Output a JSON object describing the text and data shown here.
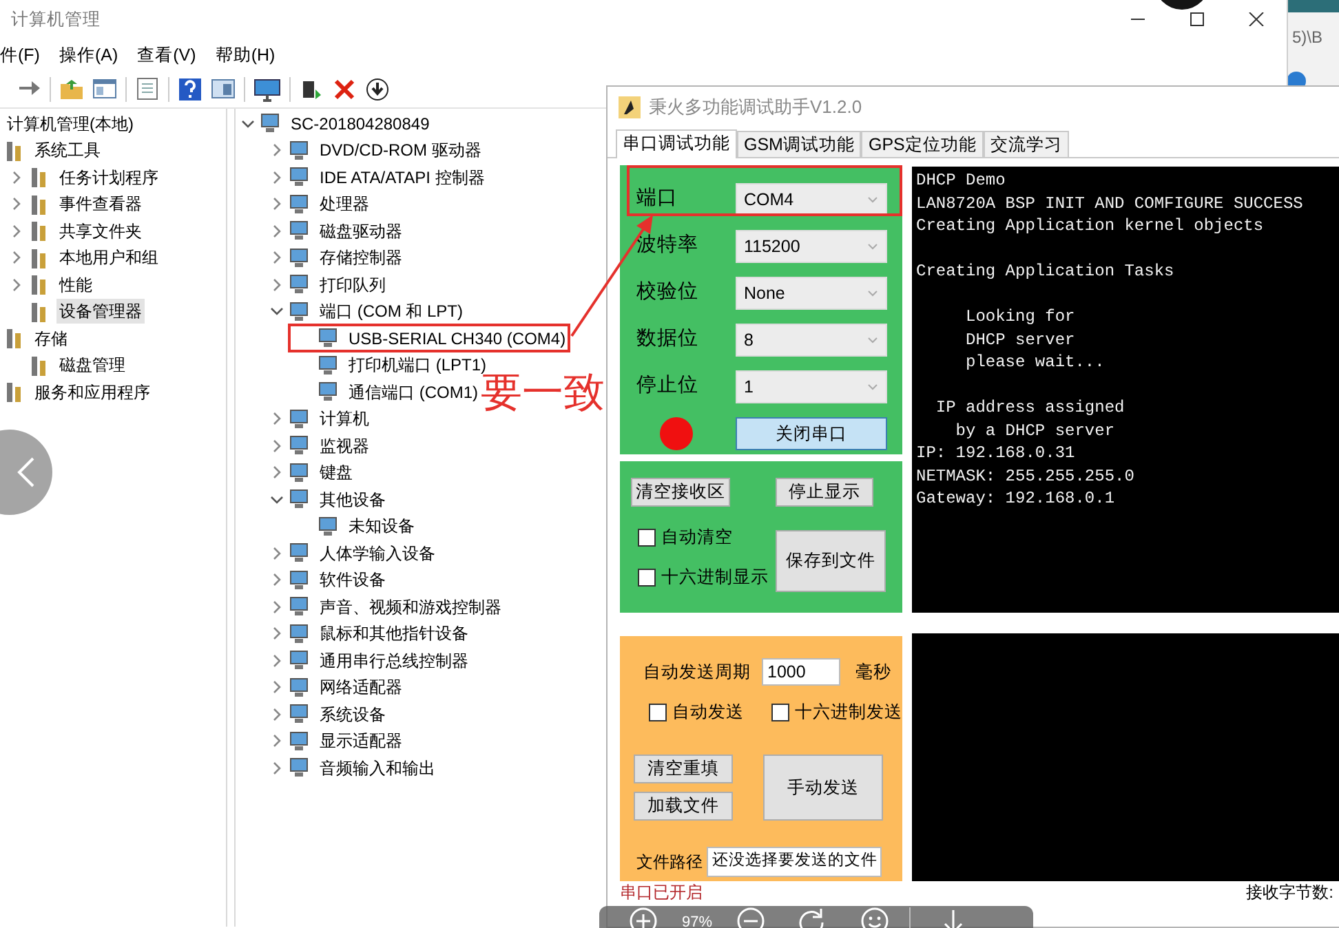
{
  "main_window": {
    "title": "计算机管理",
    "menu": [
      "件(F)",
      "操作(A)",
      "查看(V)",
      "帮助(H)"
    ],
    "nav_tree": [
      {
        "label": "计算机管理(本地)",
        "selected": false,
        "children": [
          {
            "label": "系统工具",
            "selected": false,
            "children": [
              {
                "label": "任务计划程序",
                "expanded": false,
                "selected": false
              },
              {
                "label": "事件查看器",
                "expanded": false,
                "selected": false
              },
              {
                "label": "共享文件夹",
                "expanded": false,
                "selected": false
              },
              {
                "label": "本地用户和组",
                "expanded": false,
                "selected": false
              },
              {
                "label": "性能",
                "expanded": false,
                "selected": false
              },
              {
                "label": "设备管理器",
                "selected": true
              }
            ]
          },
          {
            "label": "存储",
            "selected": false,
            "children": [
              {
                "label": "磁盘管理",
                "selected": false
              }
            ]
          },
          {
            "label": "服务和应用程序",
            "selected": false
          }
        ]
      }
    ],
    "device_tree": [
      {
        "label": "SC-201804280849",
        "expanded": true,
        "children": [
          {
            "label": "DVD/CD-ROM 驱动器",
            "expanded": false
          },
          {
            "label": "IDE ATA/ATAPI 控制器",
            "expanded": false
          },
          {
            "label": "处理器",
            "expanded": false
          },
          {
            "label": "磁盘驱动器",
            "expanded": false
          },
          {
            "label": "存储控制器",
            "expanded": false
          },
          {
            "label": "打印队列",
            "expanded": false
          },
          {
            "label": "端口 (COM 和 LPT)",
            "expanded": true,
            "children": [
              {
                "label": "USB-SERIAL CH340 (COM4)"
              },
              {
                "label": "打印机端口 (LPT1)"
              },
              {
                "label": "通信端口 (COM1)"
              }
            ]
          },
          {
            "label": "计算机",
            "expanded": false
          },
          {
            "label": "监视器",
            "expanded": false
          },
          {
            "label": "键盘",
            "expanded": false
          },
          {
            "label": "其他设备",
            "expanded": true,
            "children": [
              {
                "label": "未知设备"
              }
            ]
          },
          {
            "label": "人体学输入设备",
            "expanded": false
          },
          {
            "label": "软件设备",
            "expanded": false
          },
          {
            "label": "声音、视频和游戏控制器",
            "expanded": false
          },
          {
            "label": "鼠标和其他指针设备",
            "expanded": false
          },
          {
            "label": "通用串行总线控制器",
            "expanded": false
          },
          {
            "label": "网络适配器",
            "expanded": false
          },
          {
            "label": "系统设备",
            "expanded": false
          },
          {
            "label": "显示适配器",
            "expanded": false
          },
          {
            "label": "音频输入和输出",
            "expanded": false
          }
        ]
      }
    ]
  },
  "serial_tool": {
    "title": "秉火多功能调试助手V1.2.0",
    "tabs": [
      {
        "label": "串口调试功能",
        "selected": true
      },
      {
        "label": "GSM调试功能",
        "selected": false
      },
      {
        "label": "GPS定位功能",
        "selected": false
      },
      {
        "label": "交流学习",
        "selected": false
      }
    ],
    "settings": [
      {
        "label": "端口",
        "value": "COM4"
      },
      {
        "label": "波特率",
        "value": "115200"
      },
      {
        "label": "校验位",
        "value": "None"
      },
      {
        "label": "数据位",
        "value": "8"
      },
      {
        "label": "停止位",
        "value": "1"
      }
    ],
    "port_open": true,
    "open_button": "关闭串口",
    "receive_controls": {
      "clear_button": "清空接收区",
      "stop_button": "停止显示",
      "save_button": "保存到文件",
      "checkboxes": [
        {
          "label": "自动清空",
          "checked": false
        },
        {
          "label": "十六进制显示",
          "checked": false
        }
      ]
    },
    "send_controls": {
      "period_label": "自动发送周期",
      "period_value": "1000",
      "period_unit": "毫秒",
      "checkboxes": [
        {
          "label": "自动发送",
          "checked": false
        },
        {
          "label": "十六进制发送",
          "checked": false
        }
      ],
      "clear_button": "清空重填",
      "load_button": "加载文件",
      "send_button": "手动发送",
      "path_label": "文件路径",
      "path_value": "还没选择要发送的文件"
    },
    "receive_log": "DHCP Demo\nLAN8720A BSP INIT AND COMFIGURE SUCCESS\nCreating Application kernel objects\n\nCreating Application Tasks\n\n     Looking for\n     DHCP server\n     please wait...\n\n  IP address assigned\n    by a DHCP server\nIP: 192.168.0.31\nNETMASK: 255.255.255.0\nGateway: 192.168.0.1",
    "status": "串口已开启",
    "byte_count_label": "接收字节数:"
  },
  "annotation": {
    "text": "要一致"
  },
  "viewer_toolbar": {
    "zoom": "97%"
  },
  "background_window": {
    "text": "5)\\B"
  }
}
